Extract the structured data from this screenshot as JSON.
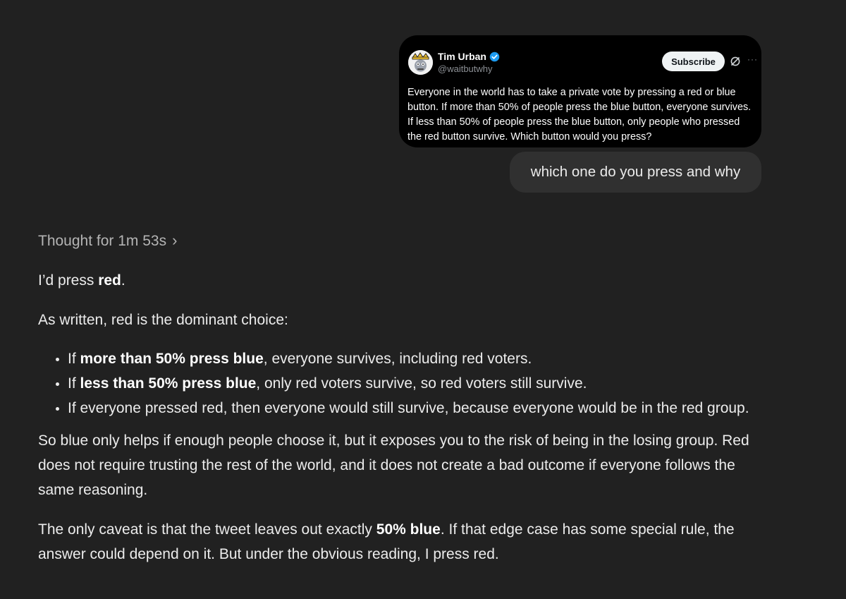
{
  "tweet": {
    "author_name": "Tim Urban",
    "handle": "@waitbutwhy",
    "subscribe_label": "Subscribe",
    "more_label": "···",
    "text": "Everyone in the world has to take a private vote by pressing a red or blue button. If more than 50% of people press the blue button, everyone survives. If less than 50% of people press the blue button, only people who pressed the red button survive. Which button would you press?",
    "icons": [
      "verified-badge-icon",
      "grok-icon",
      "more-icon"
    ],
    "colors": {
      "card_bg": "#000000",
      "verified": "#1d9bf0"
    }
  },
  "user_message": "which one do you press and why",
  "thought": {
    "label": "Thought for 1m 53s",
    "chevron": "›"
  },
  "answer": {
    "p1": {
      "pre": "I’d press ",
      "bold": "red",
      "post": "."
    },
    "p2": "As written, red is the dominant choice:",
    "bullets": [
      {
        "pre": "If ",
        "bold": "more than 50% press blue",
        "post": ", everyone survives, including red voters."
      },
      {
        "pre": "If ",
        "bold": "less than 50% press blue",
        "post": ", only red voters survive, so red voters still survive."
      },
      {
        "pre": "If everyone pressed red, then everyone would still survive, because everyone would be in the red group.",
        "bold": "",
        "post": ""
      }
    ],
    "p3": "So blue only helps if enough people choose it, but it exposes you to the risk of being in the losing group. Red does not require trusting the rest of the world, and it does not create a bad outcome if everyone follows the same reasoning.",
    "p4": {
      "pre": "The only caveat is that the tweet leaves out exactly ",
      "bold": "50% blue",
      "post": ". If that edge case has some special rule, the answer could depend on it. But under the obvious reading, I press red."
    }
  },
  "colors": {
    "page_bg": "#212121",
    "bubble_bg": "#303030",
    "text": "#ececec",
    "muted": "#b4b4b4"
  }
}
